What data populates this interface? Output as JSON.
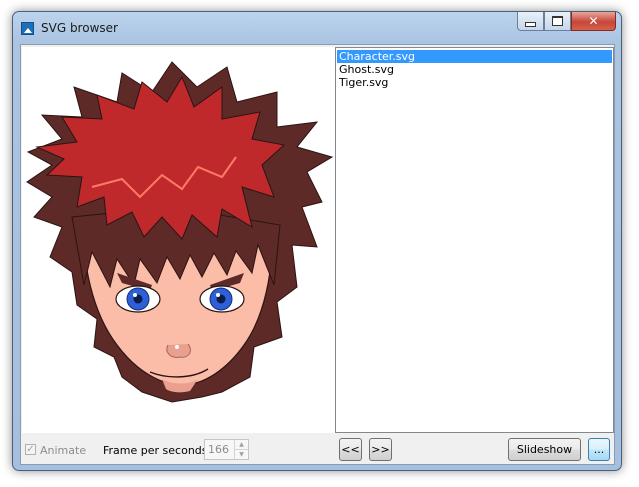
{
  "window": {
    "title": "SVG browser",
    "close_glyph": "✕"
  },
  "files": [
    {
      "name": "Character.svg",
      "selected": true
    },
    {
      "name": "Ghost.svg",
      "selected": false
    },
    {
      "name": "Tiger.svg",
      "selected": false
    }
  ],
  "controls": {
    "animate_label": "Animate",
    "animate_checked": true,
    "animate_enabled": false,
    "fps_label": "Frame per seconds:",
    "fps_value": "166",
    "prev_label": "<<",
    "next_label": ">>",
    "slideshow_label": "Slideshow",
    "more_label": "..."
  },
  "colors": {
    "hair_front": "#c0292c",
    "hair_back": "#5e2a28",
    "skin": "#fbbda8",
    "iris": "#2f5fd6",
    "selection": "#3399ff"
  }
}
